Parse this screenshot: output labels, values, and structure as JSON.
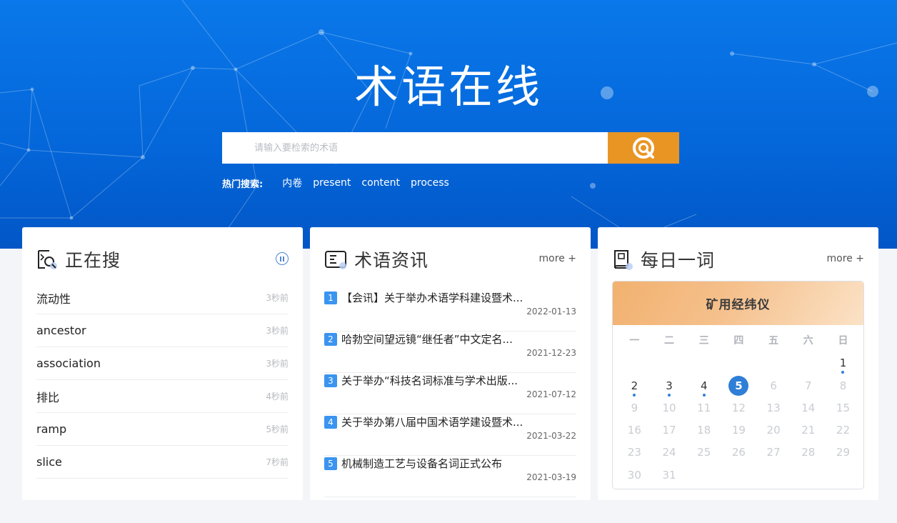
{
  "site": {
    "title": "术语在线"
  },
  "search": {
    "placeholder": "请输入要检索的术语",
    "button_icon": "search-q-icon"
  },
  "hot_search": {
    "label": "热门搜索:",
    "items": [
      "内卷",
      "present",
      "content",
      "process"
    ]
  },
  "now_searching": {
    "title": "正在搜",
    "icon": "search-doc-icon",
    "control_icon": "pause-icon",
    "items": [
      {
        "term": "流动性",
        "time": "3秒前"
      },
      {
        "term": "ancestor",
        "time": "3秒前"
      },
      {
        "term": "association",
        "time": "3秒前"
      },
      {
        "term": "排比",
        "time": "4秒前"
      },
      {
        "term": "ramp",
        "time": "5秒前"
      },
      {
        "term": "slice",
        "time": "7秒前"
      }
    ]
  },
  "news": {
    "title": "术语资讯",
    "icon": "news-icon",
    "more": "more +",
    "items": [
      {
        "num": "1",
        "title": "【会讯】关于举办术语学科建设暨术...",
        "date": "2022-01-13"
      },
      {
        "num": "2",
        "title": "哈勃空间望远镜“继任者”中文定名...",
        "date": "2021-12-23"
      },
      {
        "num": "3",
        "title": "关于举办“科技名词标准与学术出版...",
        "date": "2021-07-12"
      },
      {
        "num": "4",
        "title": "关于举办第八届中国术语学建设暨术...",
        "date": "2021-03-22"
      },
      {
        "num": "5",
        "title": "机械制造工艺与设备名词正式公布",
        "date": "2021-03-19"
      }
    ]
  },
  "daily_word": {
    "title": "每日一词",
    "icon": "book-icon",
    "more": "more +",
    "word": "矿用经纬仪",
    "weekdays": [
      "一",
      "二",
      "三",
      "四",
      "五",
      "六",
      "日"
    ],
    "weeks": [
      [
        "",
        "",
        "",
        "",
        "",
        "",
        "1"
      ],
      [
        "2",
        "3",
        "4",
        "5",
        "6",
        "7",
        "8"
      ],
      [
        "9",
        "10",
        "11",
        "12",
        "13",
        "14",
        "15"
      ],
      [
        "16",
        "17",
        "18",
        "19",
        "20",
        "21",
        "22"
      ],
      [
        "23",
        "24",
        "25",
        "26",
        "27",
        "28",
        "29"
      ],
      [
        "30",
        "31",
        "",
        "",
        "",
        "",
        ""
      ]
    ],
    "active_days": [
      "1",
      "2",
      "3",
      "4"
    ],
    "today": "5"
  },
  "colors": {
    "hero": "#0a78ea",
    "search_button": "#e99524",
    "accent": "#2f7fd6",
    "news_badge": "#3a94f0"
  }
}
